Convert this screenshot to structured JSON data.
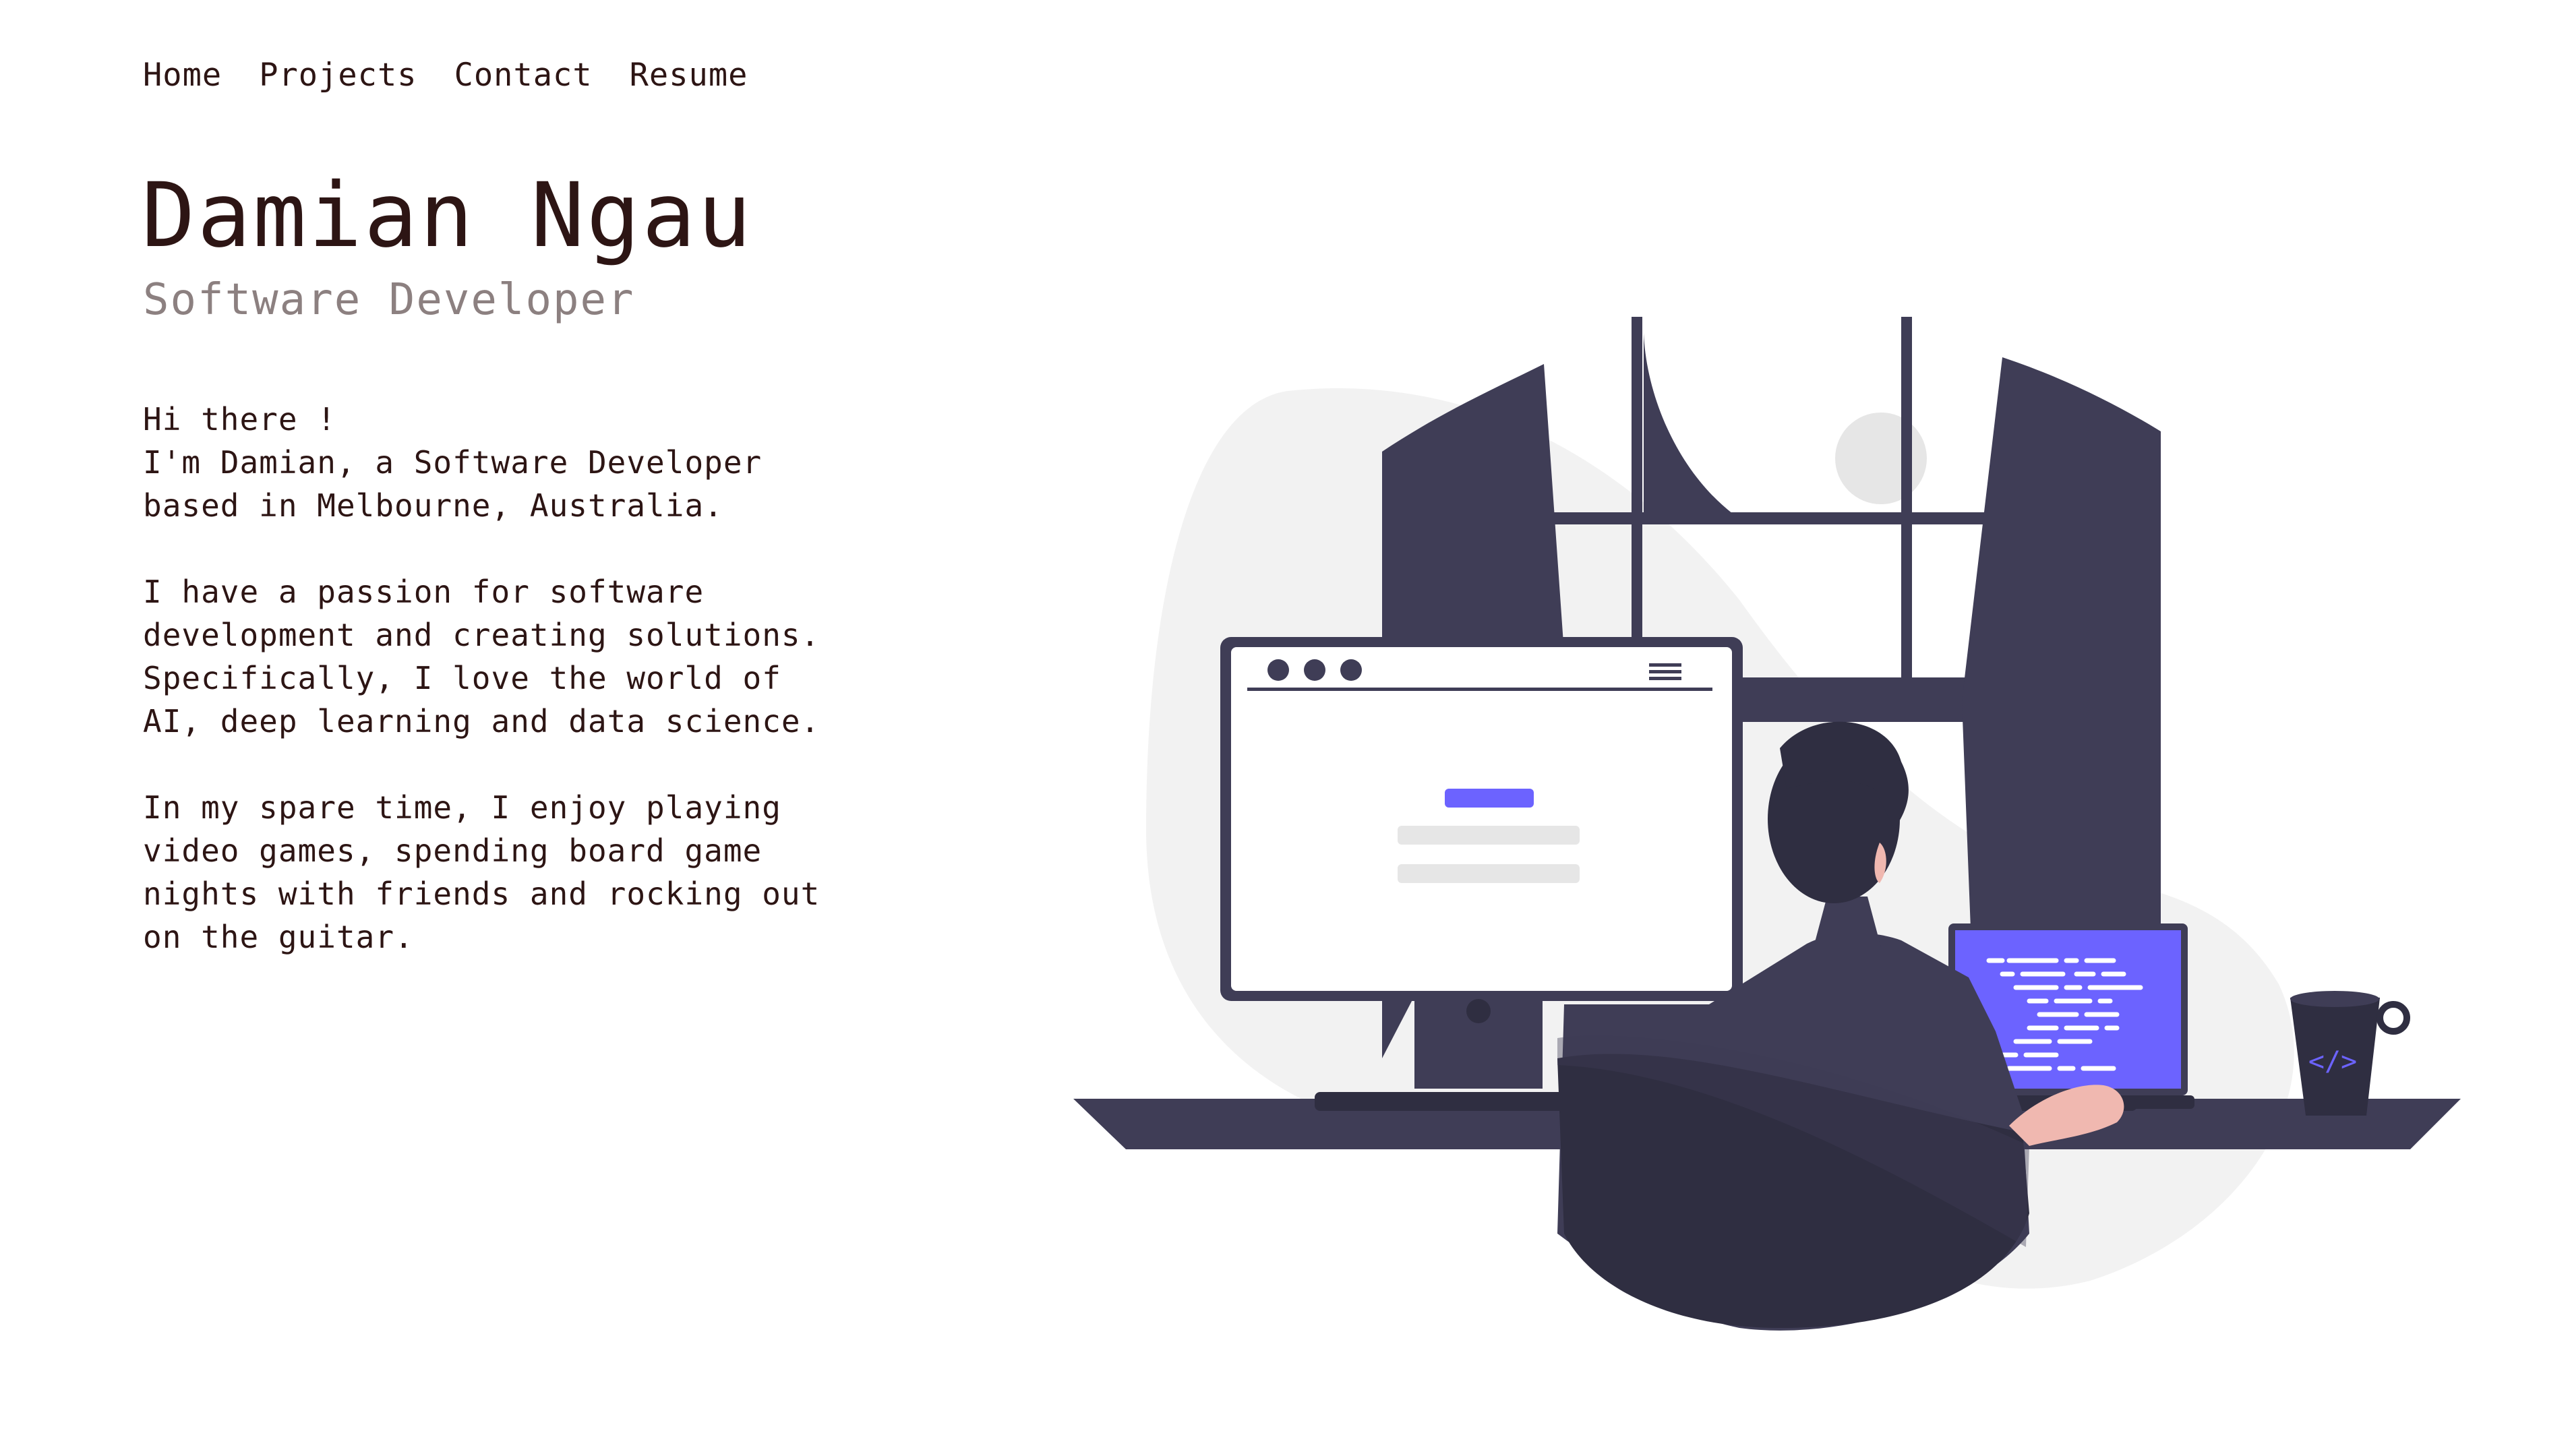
{
  "nav": {
    "items": [
      {
        "label": "Home"
      },
      {
        "label": "Projects"
      },
      {
        "label": "Contact"
      },
      {
        "label": "Resume"
      }
    ]
  },
  "hero": {
    "name": "Damian Ngau",
    "role": "Software Developer"
  },
  "bio": {
    "paragraph1": [
      "Hi there !",
      "I'm Damian, a Software Developer",
      "based in Melbourne, Australia."
    ],
    "paragraph2": [
      "I have a passion for software",
      "development and creating solutions.",
      "Specifically, I love the world of",
      "AI, deep learning and data science."
    ],
    "paragraph3": [
      "In my spare time, I enjoy playing",
      "video games, spending board game",
      "nights with friends and rocking out",
      "on the guitar."
    ]
  },
  "illustration": {
    "accent_color": "#6c63ff",
    "dark_color": "#3f3d56",
    "darker_color": "#2f2e41",
    "skin_color": "#f0b8b0",
    "bg_blob_color": "#f2f2f2",
    "mug_symbol": "</>"
  },
  "colors": {
    "text": "#2d1514",
    "subtle_text": "#8c8080"
  }
}
